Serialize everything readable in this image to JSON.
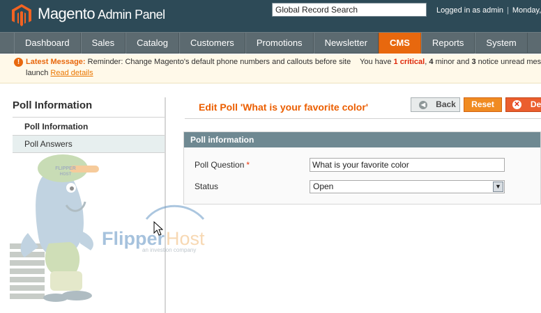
{
  "header": {
    "logo_brand": "Magento",
    "logo_suffix": "Admin Panel",
    "search_value": "Global Record Search",
    "logged_in": "Logged in as admin",
    "date": "Monday,"
  },
  "nav": {
    "items": [
      "Dashboard",
      "Sales",
      "Catalog",
      "Customers",
      "Promotions",
      "Newsletter",
      "CMS",
      "Reports",
      "System"
    ],
    "active": "CMS"
  },
  "notice": {
    "label": "Latest Message:",
    "text": "Reminder: Change Magento's default phone numbers and callouts before site",
    "text_line2": "launch",
    "link": "Read details",
    "right_prefix": "You have",
    "critical_count": "1 critical",
    "minor": "4",
    "minor_text": "minor and",
    "notice_count": "3",
    "notice_text": "notice unread mess"
  },
  "sidebar": {
    "title": "Poll Information",
    "tabs": [
      "Poll Information",
      "Poll Answers"
    ]
  },
  "page": {
    "title": "Edit Poll 'What is your favorite color'",
    "back_label": "Back",
    "reset_label": "Reset",
    "delete_label": "Dele"
  },
  "form": {
    "legend": "Poll information",
    "question_label": "Poll Question",
    "question_required": "*",
    "question_value": "What is your favorite color",
    "status_label": "Status",
    "status_value": "Open"
  },
  "watermark": {
    "brand": "FlipperHost",
    "tagline": "an investion company",
    "cap_text": "FLIPPER HOST"
  },
  "colors": {
    "header_bg": "#2d4a57",
    "nav_bg": "#5c6a70",
    "accent": "#e8680e",
    "title": "#eb5e00",
    "fieldset_head": "#6f8992"
  }
}
